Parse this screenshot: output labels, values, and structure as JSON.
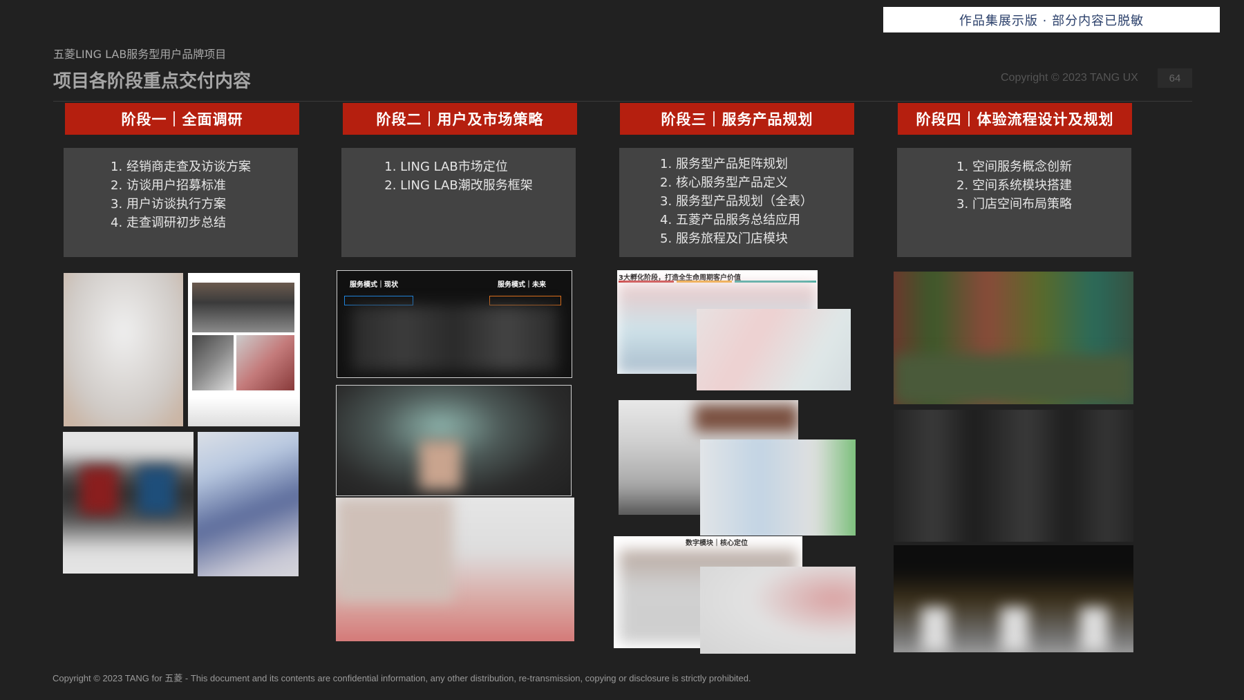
{
  "banner": "作品集展示版 ·   部分内容已脱敏",
  "header": {
    "project": "五菱LING LAB服务型用户品牌项目",
    "title": "项目各阶段重点交付内容",
    "copyright": "Copyright © 2023 TANG UX",
    "page_number": "64"
  },
  "stages": [
    {
      "title": "阶段一｜全面调研",
      "items": [
        "1.  经销商走查及访谈方案",
        "2.  访谈用户招募标准",
        "3.  用户访谈执行方案",
        "4.  走查调研初步总结"
      ]
    },
    {
      "title": "阶段二｜用户及市场策略",
      "items": [
        "1.  LING LAB市场定位",
        "2.  LING LAB潮改服务框架"
      ]
    },
    {
      "title": "阶段三｜服务产品规划",
      "items": [
        "1.  服务型产品矩阵规划",
        "2.  核心服务型产品定义",
        "3.  服务型产品规划（全表）",
        "4.  五菱产品服务总结应用",
        "5.  服务旅程及门店模块"
      ]
    },
    {
      "title": "阶段四｜体验流程设计及规划",
      "items": [
        "1.  空间服务概念创新",
        "2.  空间系统模块搭建",
        "3.  门店空间布局策略"
      ]
    }
  ],
  "thumb_labels": {
    "service_now": "服务模式｜现状",
    "service_future": "服务模式｜未来",
    "stage3_strip": "3大孵化阶段，打造全生命周期客户价值",
    "digital_module": "数字模块｜核心定位"
  },
  "footer": "Copyright © 2023 TANG for 五菱 - This document and its contents are confidential information, any other distribution, re-transmission, copying or disclosure is strictly prohibited.",
  "colors": {
    "background": "#212121",
    "stage_header": "#b51f0f",
    "stage_box": "#434343"
  }
}
